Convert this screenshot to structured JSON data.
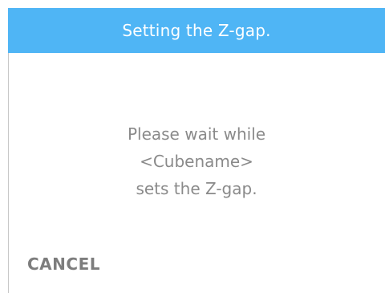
{
  "header": {
    "title": "Setting the Z-gap.",
    "background_color": "#4fb5f5"
  },
  "message": {
    "lines": [
      "Please wait while",
      "<Cubename>",
      "sets the Z-gap."
    ]
  },
  "actions": {
    "cancel_label": "CANCEL"
  }
}
